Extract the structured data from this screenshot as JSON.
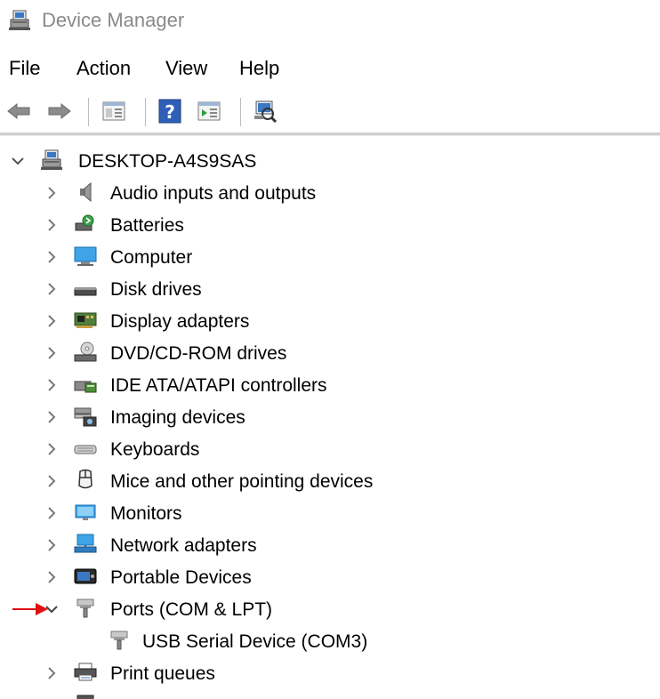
{
  "window": {
    "title": "Device Manager"
  },
  "menu": {
    "items": [
      "File",
      "Action",
      "View",
      "Help"
    ]
  },
  "toolbar": {
    "buttons": [
      "back-arrow-icon",
      "forward-arrow-icon",
      "properties-icon",
      "help-icon",
      "update-driver-icon",
      "scan-hardware-icon"
    ]
  },
  "tree": {
    "root": "DESKTOP-A4S9SAS",
    "categories": [
      {
        "label": "Audio inputs and outputs",
        "icon": "speaker-icon",
        "expanded": false
      },
      {
        "label": "Batteries",
        "icon": "battery-icon",
        "expanded": false
      },
      {
        "label": "Computer",
        "icon": "computer-icon",
        "expanded": false
      },
      {
        "label": "Disk drives",
        "icon": "disk-drive-icon",
        "expanded": false
      },
      {
        "label": "Display adapters",
        "icon": "display-adapter-icon",
        "expanded": false
      },
      {
        "label": "DVD/CD-ROM drives",
        "icon": "dvd-drive-icon",
        "expanded": false
      },
      {
        "label": "IDE ATA/ATAPI controllers",
        "icon": "ide-controller-icon",
        "expanded": false
      },
      {
        "label": "Imaging devices",
        "icon": "camera-icon",
        "expanded": false
      },
      {
        "label": "Keyboards",
        "icon": "keyboard-icon",
        "expanded": false
      },
      {
        "label": "Mice and other pointing devices",
        "icon": "mouse-icon",
        "expanded": false
      },
      {
        "label": "Monitors",
        "icon": "monitor-icon",
        "expanded": false
      },
      {
        "label": "Network adapters",
        "icon": "network-adapter-icon",
        "expanded": false
      },
      {
        "label": "Portable Devices",
        "icon": "portable-device-icon",
        "expanded": false
      },
      {
        "label": "Ports (COM & LPT)",
        "icon": "port-icon",
        "expanded": true
      },
      {
        "label": "USB Serial Device (COM3)",
        "icon": "port-icon",
        "child": true
      },
      {
        "label": "Print queues",
        "icon": "printer-icon",
        "expanded": false
      }
    ]
  },
  "colors": {
    "annotation_arrow": "#e01010",
    "chevron": "#7a7a7a"
  }
}
